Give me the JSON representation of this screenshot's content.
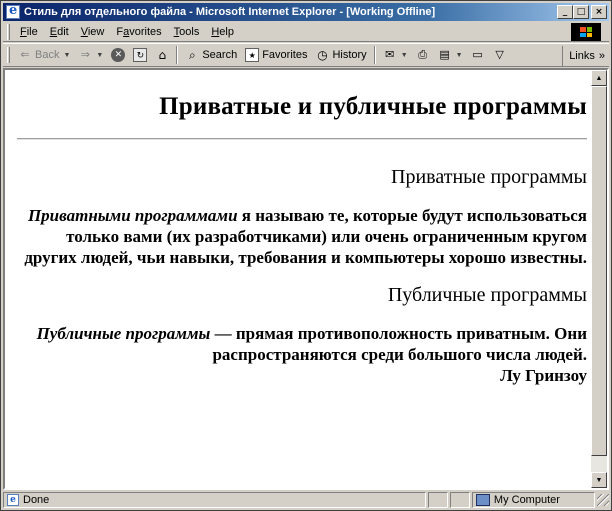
{
  "window": {
    "title": "Стиль для отдельного файла - Microsoft Internet Explorer - [Working Offline]",
    "minimize": "_",
    "maximize": "□",
    "close": "×"
  },
  "menu": {
    "items": [
      "File",
      "Edit",
      "View",
      "Favorites",
      "Tools",
      "Help"
    ],
    "underline": [
      "F",
      "E",
      "V",
      "a",
      "T",
      "H"
    ]
  },
  "toolbar": {
    "back": "Back",
    "search": "Search",
    "favorites": "Favorites",
    "history": "History",
    "links": "Links",
    "links_chevron": "»"
  },
  "page": {
    "heading": "Приватные и публичные программы",
    "section1_title": "Приватные программы",
    "section1_term": "Приватными программами",
    "section1_text": " я называю те, которые будут использоваться только вами (их разработчиками) или очень ограниченным кругом других людей, чьи навыки, требования и компьютеры хорошо известны.",
    "section2_title": "Публичные программы",
    "section2_term": "Публичные программы",
    "section2_text": " — прямая противоположность приватным. Они распространяются среди большого числа людей.",
    "author": "Лу Гринзоу"
  },
  "status": {
    "text": "Done",
    "zone": "My Computer"
  }
}
